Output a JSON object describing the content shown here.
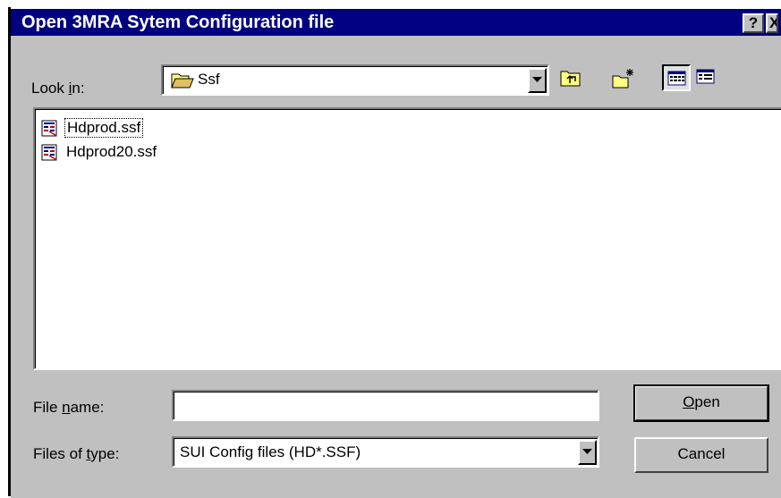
{
  "window": {
    "title": "Open 3MRA Sytem Configuration file",
    "help_glyph": "?",
    "close_glyph": "X"
  },
  "look_in": {
    "label_pre": "Look ",
    "label_accel": "i",
    "label_post": "n:",
    "value": "Ssf",
    "icon": "folder-open-icon"
  },
  "toolbar": {
    "buttons": [
      {
        "name": "up-one-level-icon"
      },
      {
        "name": "create-new-folder-icon"
      },
      {
        "name": "list-view-icon",
        "pressed": true
      },
      {
        "name": "details-view-icon",
        "pressed": false
      }
    ]
  },
  "files": [
    {
      "name": "Hdprod.ssf",
      "icon": "ssf-file-icon",
      "focused": true
    },
    {
      "name": "Hdprod20.ssf",
      "icon": "ssf-file-icon",
      "focused": false
    }
  ],
  "file_name": {
    "label_pre": "File ",
    "label_accel": "n",
    "label_post": "ame:",
    "value": ""
  },
  "file_type": {
    "label_pre": "Files of ",
    "label_accel": "t",
    "label_post": "ype:",
    "value": "SUI Config files (HD*.SSF)"
  },
  "buttons": {
    "open_accel": "O",
    "open_rest": "pen",
    "cancel": "Cancel"
  },
  "colors": {
    "titlebar": "#000080",
    "face": "#c0c0c0"
  }
}
